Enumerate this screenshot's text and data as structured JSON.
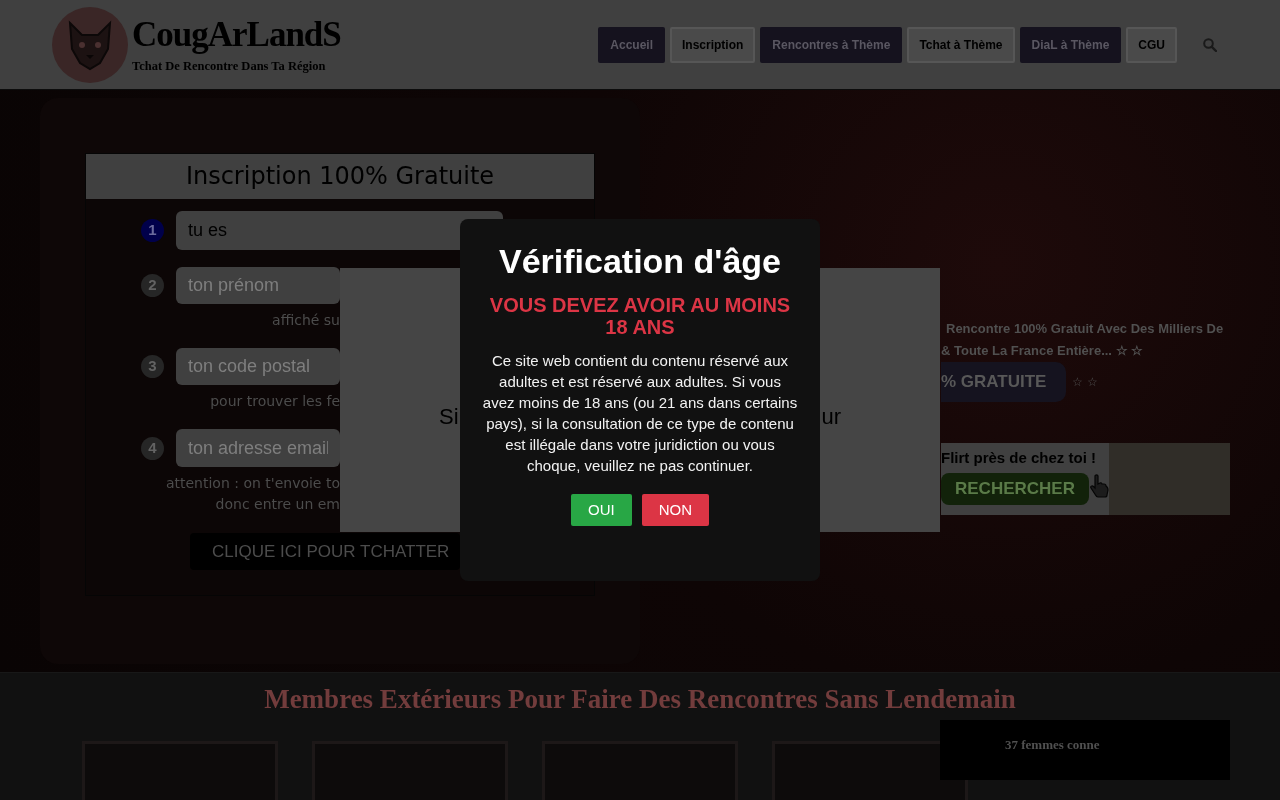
{
  "header": {
    "logo_title": "CougArLandS",
    "logo_tagline": "Tchat De Rencontre Dans Ta Région",
    "nav": [
      {
        "label": "Accueil",
        "kind": "filled"
      },
      {
        "label": "Inscription",
        "kind": "outline"
      },
      {
        "label": "Rencontres à Thème",
        "kind": "filled"
      },
      {
        "label": "Tchat à Thème",
        "kind": "outline"
      },
      {
        "label": "DiaL à Thème",
        "kind": "filled"
      },
      {
        "label": "CGU",
        "kind": "outline"
      }
    ]
  },
  "signup_form": {
    "title": "Inscription 100% Gratuite",
    "steps": [
      {
        "number": "1",
        "active": true,
        "value": "tu es"
      },
      {
        "number": "2",
        "active": false,
        "placeholder": "ton prénom",
        "hints": [
          "affiché su"
        ]
      },
      {
        "number": "3",
        "active": false,
        "placeholder": "ton code postal",
        "hints": [
          "pour trouver les fe"
        ]
      },
      {
        "number": "4",
        "active": false,
        "placeholder": "ton adresse email",
        "hints": [
          "attention : on t'envoie to",
          "donc entre un em"
        ]
      }
    ],
    "submit": "CLIQUE ICI POUR TCHATTER"
  },
  "background_popup": {
    "text_left": "Si",
    "text_right": "ur"
  },
  "promo": {
    "lines": [
      "Rencontre 100% Gratuit Avec Des Milliers De",
      "& Toute La France Entière... ☆ ☆"
    ],
    "button": "% GRATUITE",
    "button_stars": "☆ ☆",
    "banner": {
      "headline": "Flirt près de chez toi !",
      "button": "RECHERCHER"
    }
  },
  "age_modal": {
    "title": "Vérification d'âge",
    "warning": "VOUS DEVEZ AVOIR AU MOINS 18 ANS",
    "message": "Ce site web contient du contenu réservé aux adultes et est réservé aux adultes. Si vous avez moins de 18 ans (ou 21 ans dans certains pays), si la consultation de ce type de contenu est illégale dans votre juridiction ou vous choque, veuillez ne pas continuer.",
    "buttons": [
      {
        "label": "OUI",
        "kind": "accept"
      },
      {
        "label": "NON",
        "kind": "decline"
      }
    ]
  },
  "members": {
    "title": "Membres Extérieurs Pour Faire Des Rencontres Sans Lendemain",
    "online_box": "37 femmes conne"
  }
}
